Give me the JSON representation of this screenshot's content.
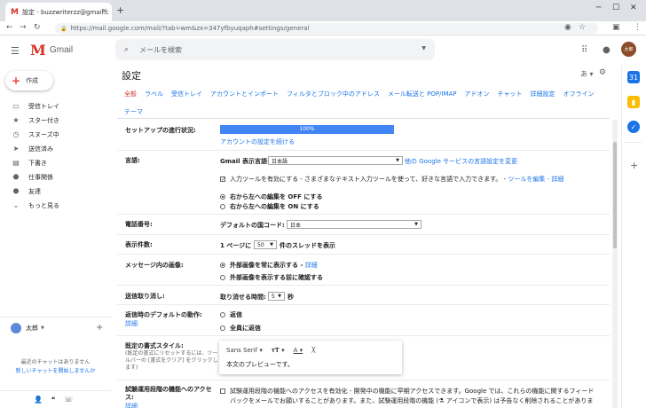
{
  "browser": {
    "tab_title": "設定 - buzzwriterzz@gmail.com",
    "url": "https://mail.google.com/mail/?tab=wm&zx=347yfbyuqaph#settings/general"
  },
  "app": {
    "name": "Gmail",
    "search_placeholder": "メールを検索",
    "avatar_text": "太郎"
  },
  "sidebar": {
    "compose_label": "作成",
    "items": [
      {
        "label": "受信トレイ",
        "icon": "inbox-icon"
      },
      {
        "label": "スター付き",
        "icon": "star-icon"
      },
      {
        "label": "スヌーズ中",
        "icon": "clock-icon"
      },
      {
        "label": "送信済み",
        "icon": "send-icon"
      },
      {
        "label": "下書き",
        "icon": "draft-icon"
      },
      {
        "label": "仕事関係",
        "icon": "label-icon"
      },
      {
        "label": "友達",
        "icon": "label-icon"
      },
      {
        "label": "もっと見る",
        "icon": "chevron-down-icon"
      }
    ],
    "user_name": "太郎",
    "no_chats": "最近のチャットはありません",
    "new_chat": "新しいチャットを開始しませんか"
  },
  "settings": {
    "title": "設定",
    "lang_indicator": "あ",
    "tabs": [
      "全般",
      "ラベル",
      "受信トレイ",
      "アカウントとインポート",
      "フィルタとブロック中のアドレス",
      "メール転送と POP/IMAP",
      "アドオン",
      "チャット",
      "詳細設定",
      "オフライン",
      "テーマ"
    ],
    "rows": {
      "setup": {
        "label": "セットアップの進行状況:",
        "progress_text": "100%",
        "progress": 1.0,
        "link": "アカウントの設定を続ける"
      },
      "language": {
        "label": "言語:",
        "display_label": "Gmail 表示言語:",
        "display_value": "日本語",
        "other_link": "他の Google サービスの言語設定を変更",
        "input_tools": "入力ツールを有効にする - さまざまなテキスト入力ツールを使って、好きな言語で入力できます。 -",
        "input_tools_link": "ツールを編集 - 詳細",
        "rtl_off": "右から左への編集を OFF にする",
        "rtl_on": "右から左への編集を ON にする"
      },
      "phone": {
        "label": "電話番号:",
        "country_label": "デフォルトの国コード:",
        "country_value": "日本"
      },
      "page_size": {
        "label": "表示件数:",
        "prefix": "1 ページに",
        "value": "50",
        "suffix": "件のスレッドを表示"
      },
      "images": {
        "label": "メッセージ内の画像:",
        "opt1": "外部画像を常に表示する -",
        "opt1_link": "詳細",
        "opt2": "外部画像を表示する前に確認する"
      },
      "undo": {
        "label": "送信取り消し:",
        "prefix": "取り消せる時間:",
        "value": "5",
        "suffix": "秒"
      },
      "reply": {
        "label": "返信時のデフォルトの動作:",
        "link": "詳細",
        "opt1": "返信",
        "opt2": "全員に返信"
      },
      "format": {
        "label": "既定の書式スタイル:",
        "sub": "(既定の書式にリセットするには、ツールバーの [書式をクリア] をクリックします)",
        "font": "Sans Serif",
        "preview": "本文のプレビューです。"
      },
      "labs": {
        "label": "試験運用段階の機能へのアクセス:",
        "link": "詳細",
        "text1": "試験運用段階の機能へのアクセスを有効化 - 開発中の機能に早期アクセスできます。Google では、これらの機能に関するフィード",
        "text2": "バックをメールでお願いすることがあります。また、試験運用段階の機能 (⚗ アイコンで表示) は予告なく削除されることがありま"
      }
    }
  },
  "colors": {
    "accent_red": "#d93025",
    "link_blue": "#1a73e8",
    "progress_blue": "#4285f4"
  }
}
